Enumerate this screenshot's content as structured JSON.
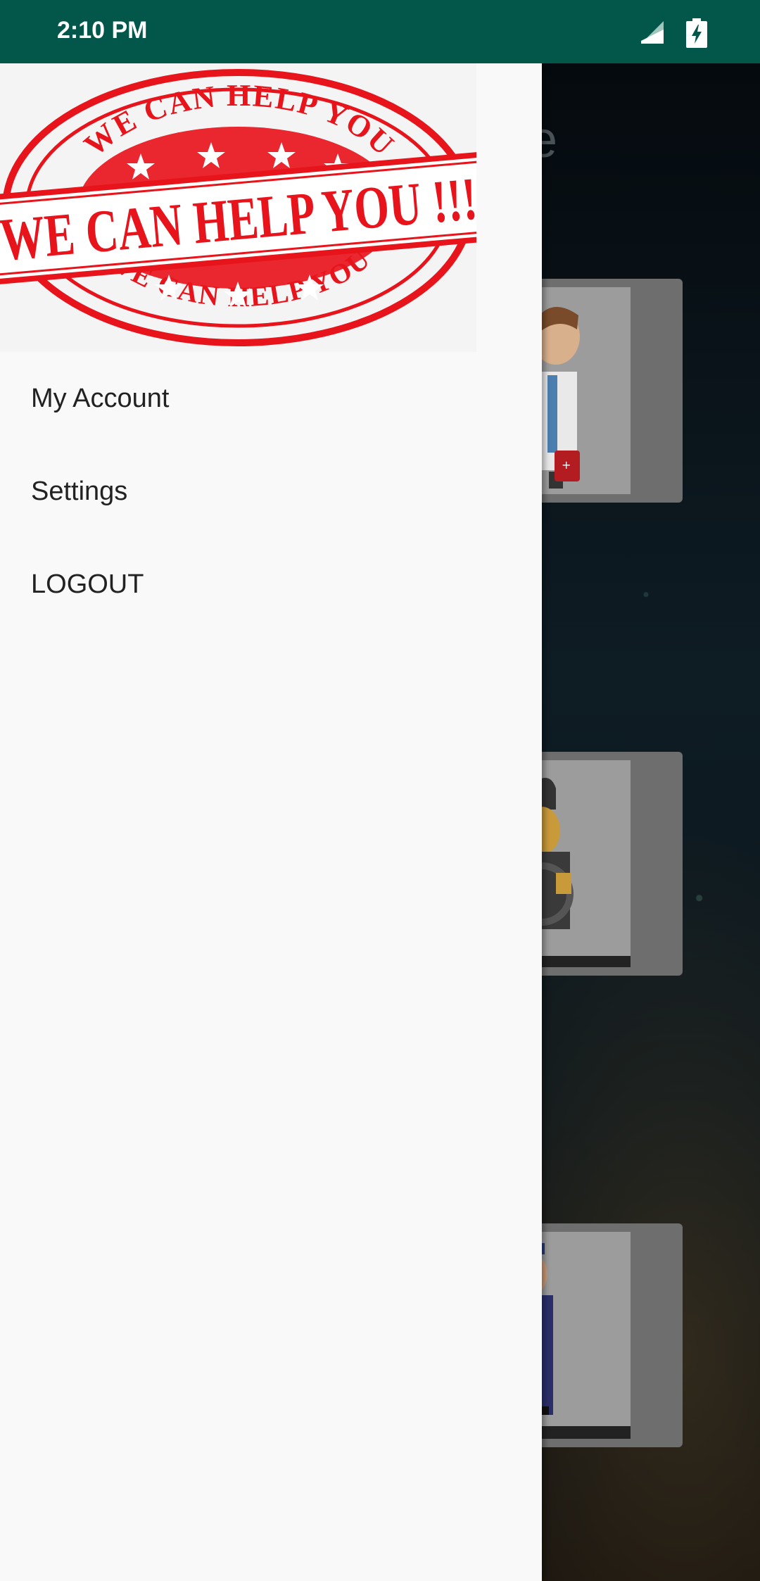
{
  "status_bar": {
    "time": "2:10 PM",
    "icons": [
      "signal-icon",
      "battery-charging-icon"
    ]
  },
  "header_logo": {
    "stamp_text_main": "WE CAN HELP YOU !!!",
    "stamp_text_ring": "WE CAN HELP YOU",
    "color": "#e8141c"
  },
  "drawer_menu": {
    "items": [
      {
        "label": "My Account"
      },
      {
        "label": "Settings"
      },
      {
        "label": "LOGOUT"
      }
    ]
  },
  "background_app": {
    "title_fragment": "e",
    "cards": [
      "doctor-image",
      "driver-image",
      "police-image"
    ]
  },
  "colors": {
    "status_bar": "#02574a",
    "drawer_bg": "#f9f9f9",
    "menu_text": "#222222"
  }
}
